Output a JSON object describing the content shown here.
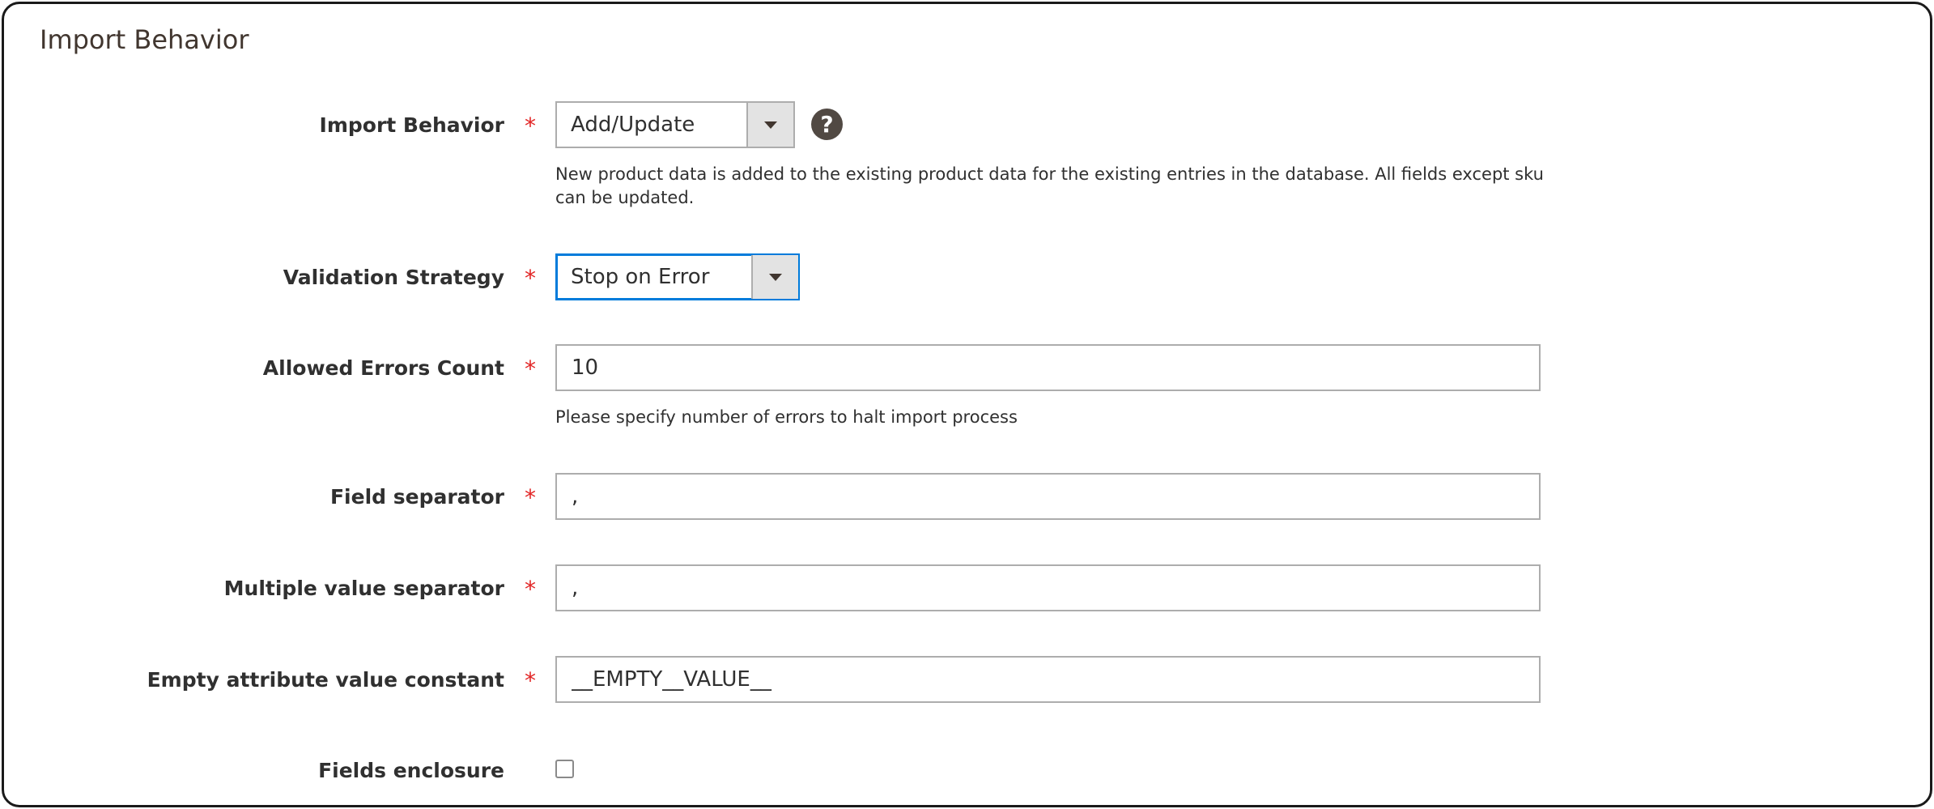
{
  "section": {
    "title": "Import Behavior"
  },
  "required_marker": "*",
  "import_behavior": {
    "label": "Import Behavior",
    "value": "Add/Update",
    "help_icon": "question-circle-icon",
    "help_glyph": "?",
    "note": "New product data is added to the existing product data for the existing entries in the database. All fields except sku can be updated."
  },
  "validation_strategy": {
    "label": "Validation Strategy",
    "value": "Stop on Error"
  },
  "allowed_errors": {
    "label": "Allowed Errors Count",
    "value": "10",
    "note": "Please specify number of errors to halt import process"
  },
  "field_separator": {
    "label": "Field separator",
    "value": ","
  },
  "multiple_value_separator": {
    "label": "Multiple value separator",
    "value": ","
  },
  "empty_attribute": {
    "label": "Empty attribute value constant",
    "value": "__EMPTY__VALUE__"
  },
  "fields_enclosure": {
    "label": "Fields enclosure",
    "checked": false
  },
  "colors": {
    "required": "#e22626",
    "focus": "#007bdb",
    "help_icon_bg": "#514943"
  }
}
